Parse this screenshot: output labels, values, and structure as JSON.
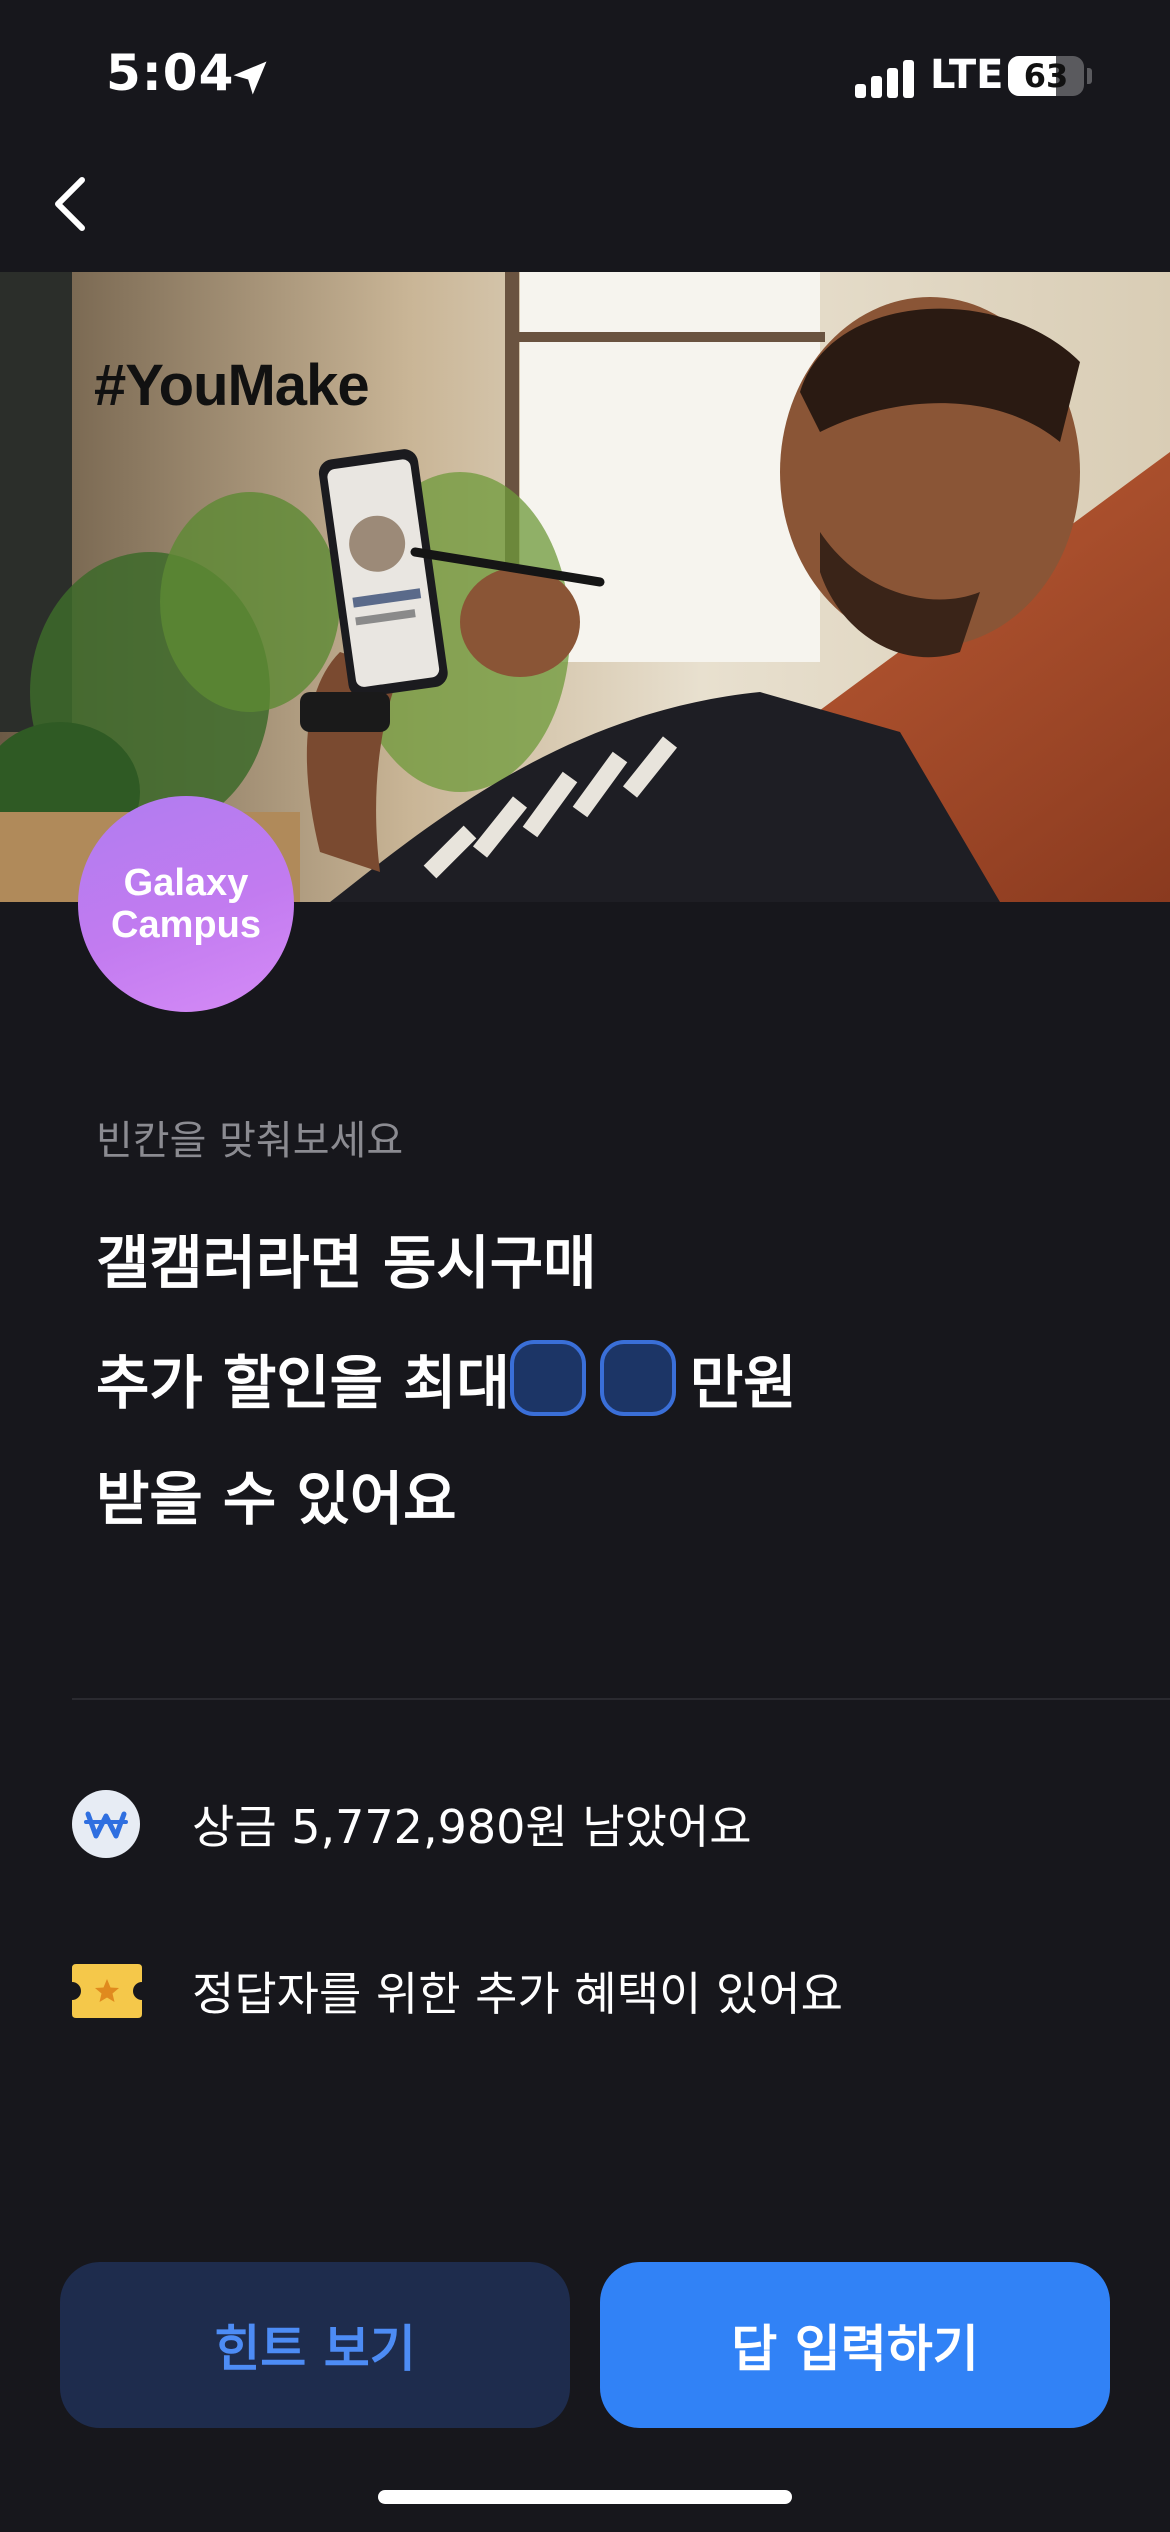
{
  "status_bar": {
    "time": "5:04",
    "network": "LTE",
    "battery_percent": "63",
    "battery_level": 0.63
  },
  "nav": {
    "back_icon": "chevron-left-icon"
  },
  "hero": {
    "hashtag": "#YouMake",
    "logo_line1": "Galaxy",
    "logo_line2": "Campus"
  },
  "question": {
    "subtitle": "빈칸을 맞춰보세요",
    "line1": "갤캠러라면 동시구매",
    "line2_prefix": "추가 할인을 최대",
    "line2_suffix": "만원",
    "line3": "받을 수 있어요",
    "blank_count": 2
  },
  "info": {
    "prize_text": "상금 5,772,980원 남았어요",
    "prize_icon": "won-coin-icon",
    "benefit_text": "정답자를 위한 추가 혜택이 있어요",
    "benefit_icon": "ticket-star-icon"
  },
  "buttons": {
    "hint": "힌트 보기",
    "answer": "답 입력하기"
  },
  "colors": {
    "background": "#17171c",
    "accent_blue": "#3182f6",
    "hint_bg": "#1e2c4d",
    "hint_text": "#4d8cf5",
    "logo_purple": "#c27bf0",
    "ticket_yellow": "#f5c84a"
  }
}
